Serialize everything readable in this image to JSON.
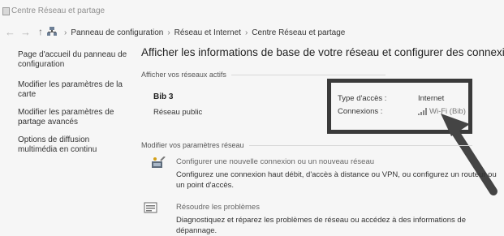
{
  "window": {
    "title": "Centre Réseau et partage"
  },
  "address": {
    "crumbs": [
      "Panneau de configuration",
      "Réseau et Internet",
      "Centre Réseau et partage"
    ]
  },
  "sidebar": {
    "items": [
      {
        "label": "Page d'accueil du panneau de configuration"
      },
      {
        "label": "Modifier les paramètres de la carte"
      },
      {
        "label": "Modifier les paramètres de partage avancés"
      },
      {
        "label": "Options de diffusion multimédia en continu"
      }
    ]
  },
  "main": {
    "title": "Afficher les informations de base de votre réseau et configurer des connexions",
    "active_header": "Afficher vos réseaux actifs",
    "network": {
      "name": "Bib 3",
      "type": "Réseau public",
      "access_label": "Type d'accès :",
      "access_value": "Internet",
      "connections_label": "Connexions :",
      "connection_value": "Wi-Fi (Bib)"
    },
    "settings_header": "Modifier vos paramètres réseau",
    "tasks": [
      {
        "link": "Configurer une nouvelle connexion ou un nouveau réseau",
        "desc": "Configurez une connexion haut débit, d'accès à distance ou VPN, ou configurez un routeur ou un point d'accès."
      },
      {
        "link": "Résoudre les problèmes",
        "desc": "Diagnostiquez et réparez les problèmes de réseau ou accédez à des informations de dépannage."
      }
    ]
  },
  "colors": {
    "highlight": "#3a3a3a",
    "link": "#777777"
  },
  "icons": [
    "back-arrow-icon",
    "forward-arrow-icon",
    "up-arrow-icon",
    "network-icon",
    "wifi-signal-icon",
    "new-connection-icon",
    "troubleshoot-icon"
  ]
}
